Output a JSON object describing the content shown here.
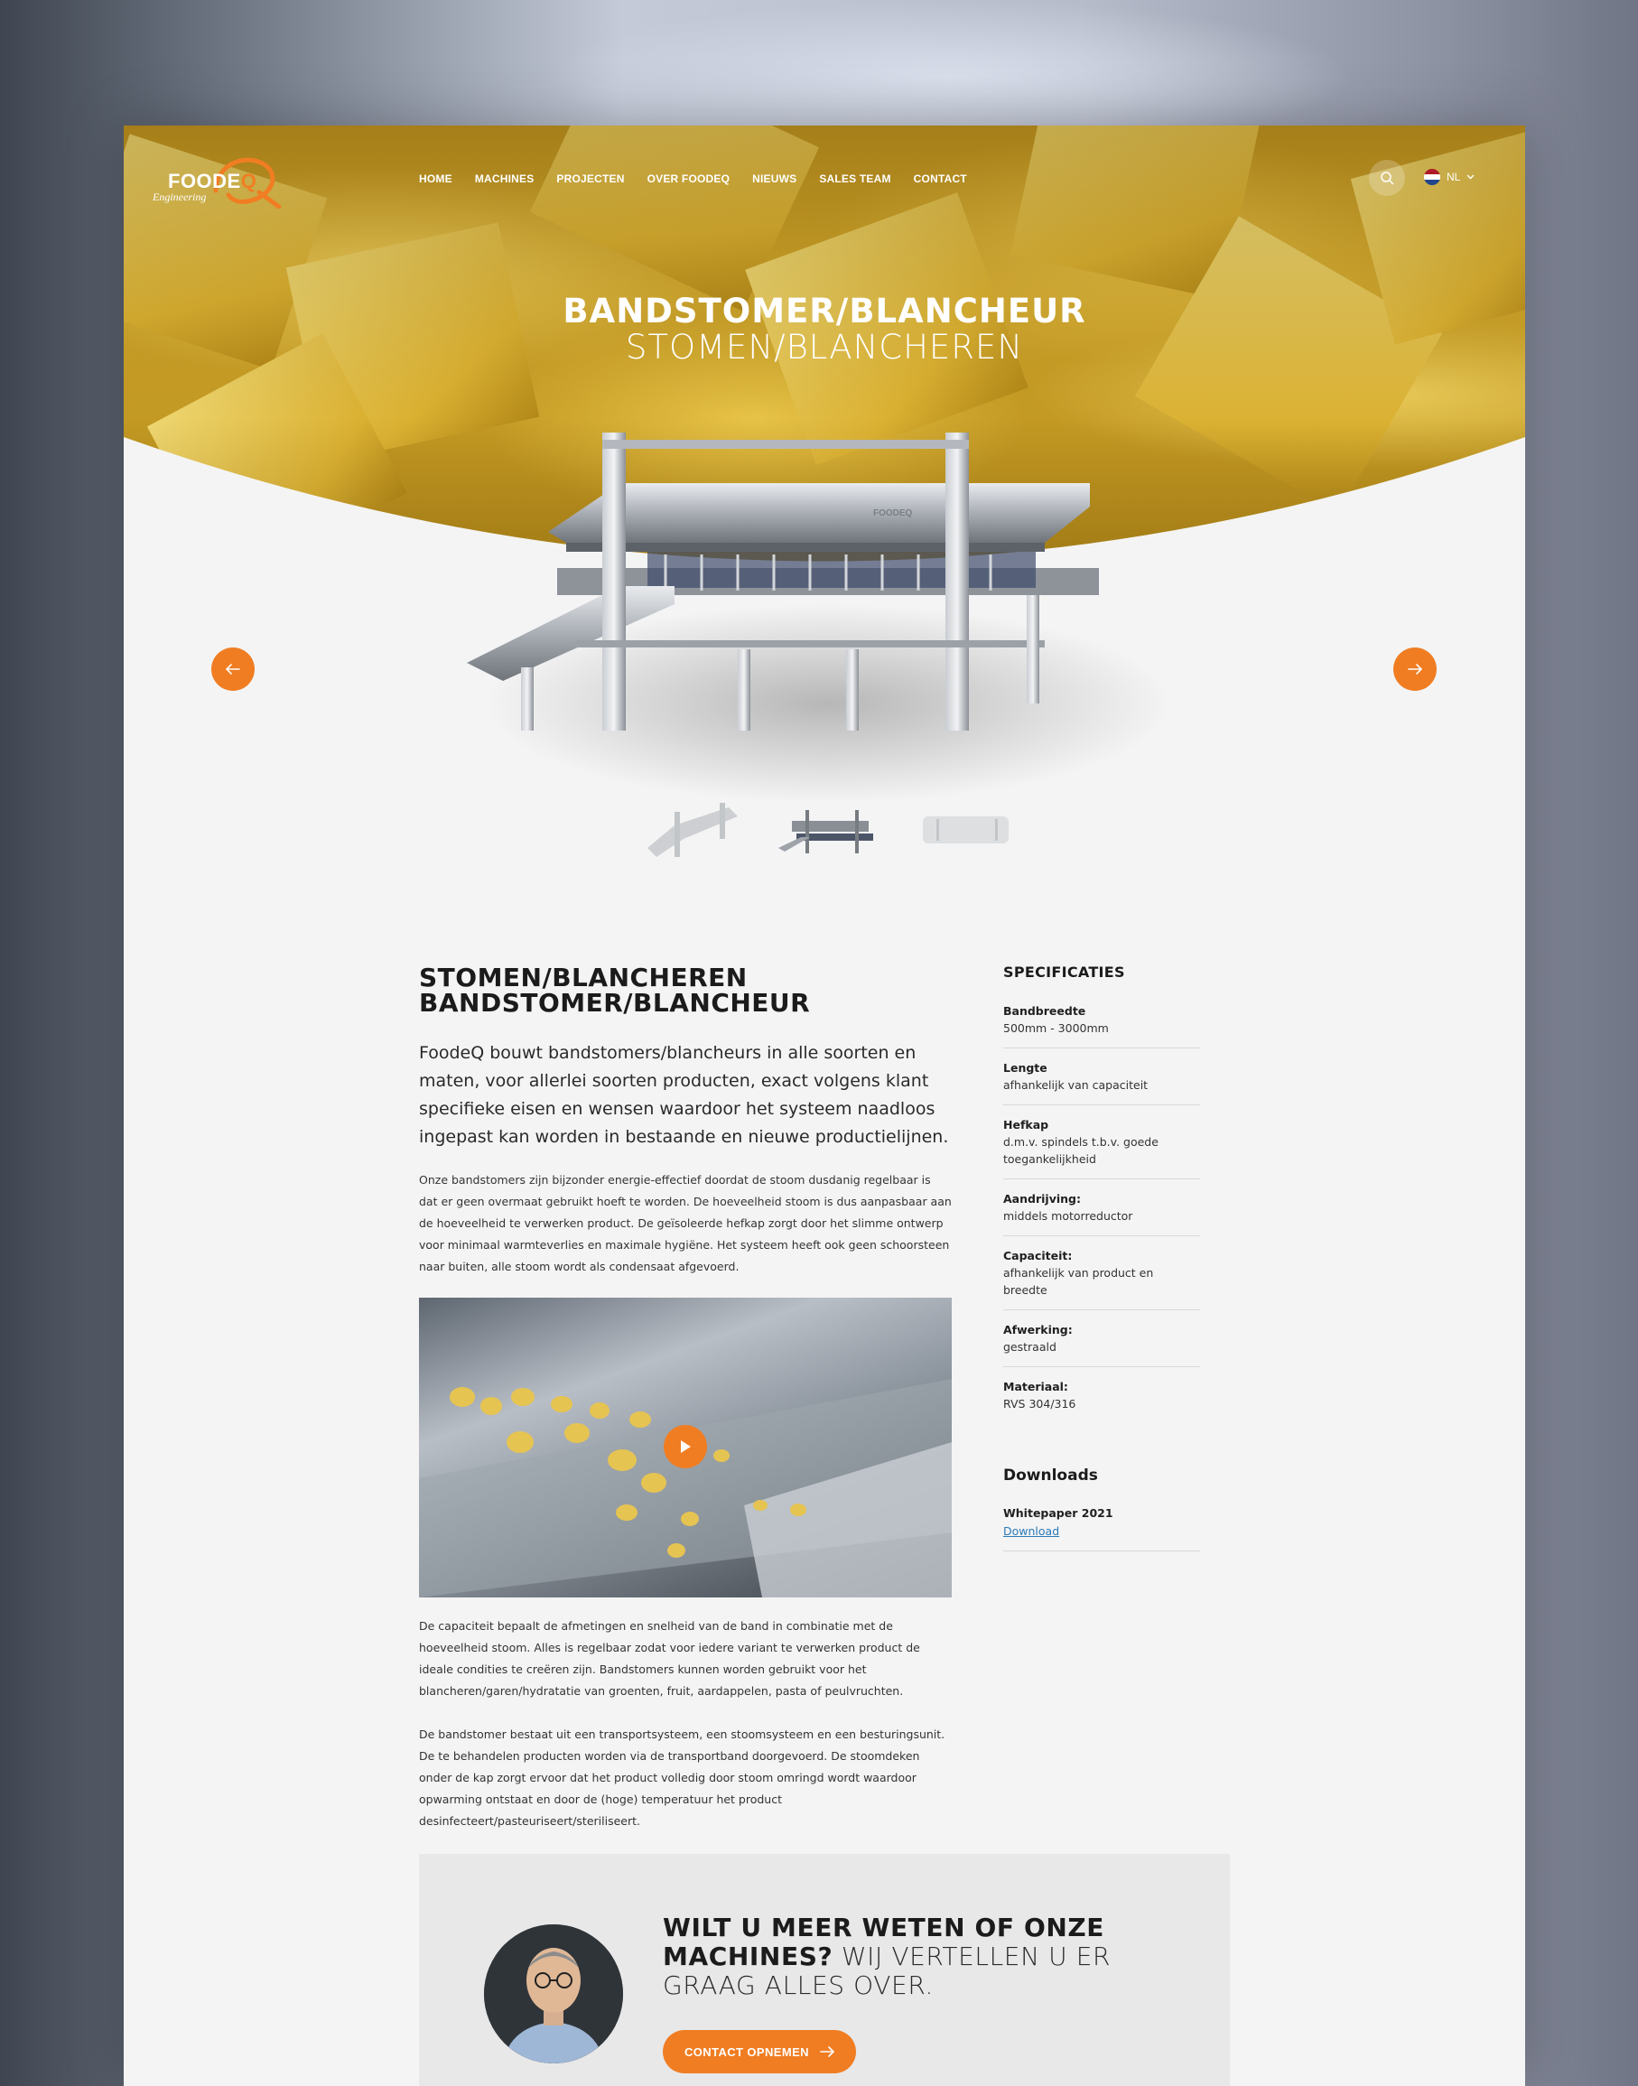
{
  "brand": {
    "logo_word": "FOODE",
    "logo_letter": "Q",
    "logo_sub": "Engineering",
    "accent": "#f07d22"
  },
  "nav": {
    "items": [
      "HOME",
      "MACHINES",
      "PROJECTEN",
      "OVER FOODEQ",
      "NIEUWS",
      "SALES TEAM",
      "CONTACT"
    ],
    "search_icon": "search-icon",
    "language": "NL"
  },
  "hero": {
    "title": "BANDSTOMER/BLANCHEUR",
    "subtitle": "STOMEN/BLANCHEREN",
    "machine_brand": "FOODEQ"
  },
  "content": {
    "heading_line1": "STOMEN/BLANCHEREN",
    "heading_line2": "BANDSTOMER/BLANCHEUR",
    "lead": "FoodeQ bouwt bandstomers/blancheurs in alle soorten en maten, voor allerlei soorten producten,  exact volgens klant specifieke eisen en wensen waardoor het systeem naadloos ingepast kan worden in bestaande en nieuwe productielijnen.",
    "para1": "Onze bandstomers zijn bijzonder energie-effectief doordat de stoom dusdanig regelbaar is dat er geen overmaat gebruikt hoeft te worden. De hoeveelheid stoom is dus aanpasbaar aan de hoeveelheid te verwerken product. De geïsoleerde hefkap zorgt door het slimme ontwerp voor minimaal warmteverlies en maximale hygiëne. Het systeem heeft ook geen schoorsteen naar buiten, alle stoom wordt als condensaat afgevoerd.",
    "para2": "De capaciteit bepaalt de afmetingen en snelheid van de band in combinatie met de hoeveelheid stoom. Alles is regelbaar zodat voor iedere variant te verwerken product de ideale condities te creëren zijn. Bandstomers kunnen worden gebruikt voor het blancheren/garen/hydratatie van groenten, fruit, aardappelen, pasta of peulvruchten.",
    "para3": "De bandstomer bestaat uit een transportsysteem, een stoomsysteem en een besturingsunit. De te behandelen producten worden via de transportband doorgevoerd. De stoomdeken onder de kap zorgt ervoor dat het product volledig door stoom omringd wordt waardoor opwarming ontstaat en door de (hoge) temperatuur het product desinfecteert/pasteuriseert/steriliseert."
  },
  "specs": {
    "title": "SPECIFICATIES",
    "items": [
      {
        "label": "Bandbreedte",
        "value": "500mm - 3000mm"
      },
      {
        "label": "Lengte",
        "value": "afhankelijk van capaciteit"
      },
      {
        "label": "Hefkap",
        "value": "d.m.v. spindels t.b.v. goede toegankelijkheid"
      },
      {
        "label": "Aandrijving:",
        "value": "middels motorreductor"
      },
      {
        "label": "Capaciteit:",
        "value": "afhankelijk van product en breedte"
      },
      {
        "label": "Afwerking:",
        "value": "gestraald"
      },
      {
        "label": "Materiaal:",
        "value": "RVS 304/316"
      }
    ]
  },
  "downloads": {
    "title": "Downloads",
    "items": [
      {
        "label": "Whitepaper 2021",
        "link": "Download"
      }
    ]
  },
  "cta": {
    "title_bold": "WILT U MEER WETEN OF ONZE MACHINES?",
    "title_light": "WIJ VERTELLEN U ER GRAAG ALLES OVER.",
    "button": "CONTACT OPNEMEN"
  }
}
